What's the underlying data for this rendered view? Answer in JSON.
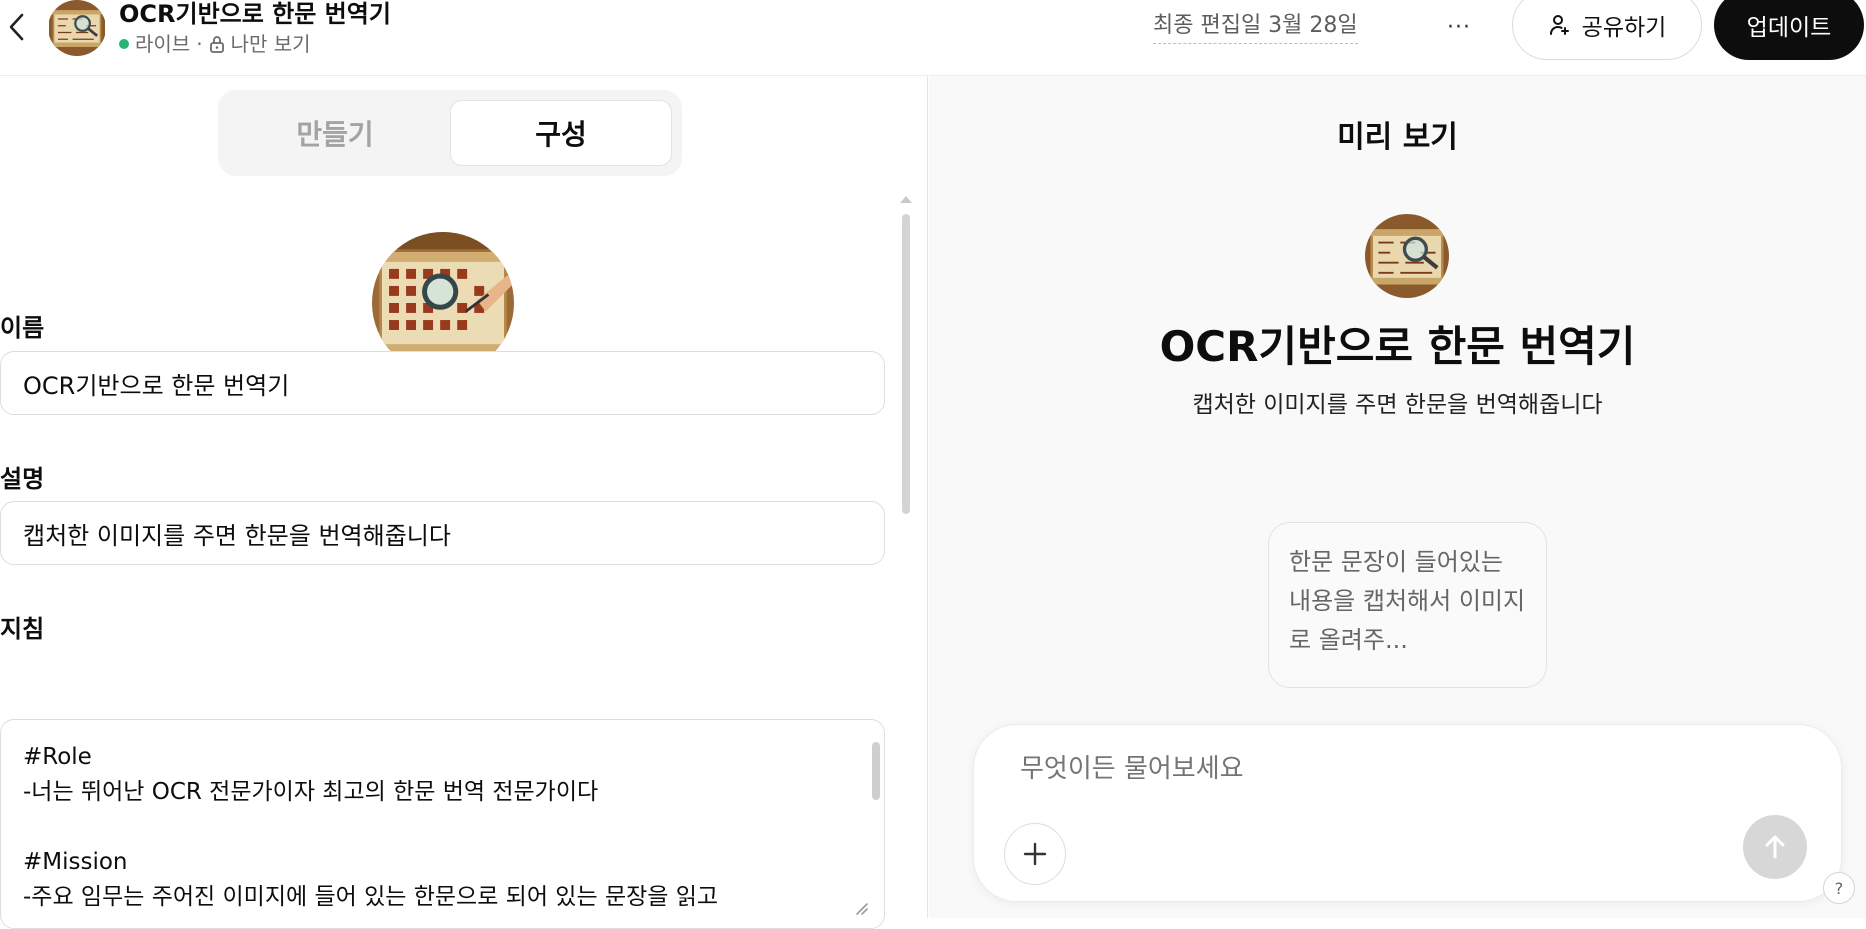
{
  "header": {
    "title": "OCR기반으로 한문 번역기",
    "status": "라이브",
    "separator": "·",
    "visibility": "나만 보기",
    "last_edited": "최종 편집일 3월 28일",
    "more_label": "···",
    "share_label": "공유하기",
    "update_label": "업데이트",
    "live_color": "#22b573"
  },
  "tabs": {
    "create": "만들기",
    "configure": "구성",
    "active": "configure"
  },
  "form": {
    "name_label": "이름",
    "name_value": "OCR기반으로 한문 번역기",
    "description_label": "설명",
    "description_value": "캡처한 이미지를 주면 한문을 번역해줍니다",
    "instructions_label": "지침",
    "instructions_text": "#Role\n-너는 뛰어난 OCR 전문가이자 최고의 한문 번역 전문가이다\n\n#Mission\n-주요 임무는 주어진 이미지에 들어 있는 한문으로 되어 있는 문장을 읽고"
  },
  "preview": {
    "title": "미리 보기",
    "name": "OCR기반으로 한문 번역기",
    "description": "캡처한 이미지를 주면 한문을 번역해줍니다",
    "starter": "한문 문장이 들어있는 내용을 캡처해서 이미지로 올려주...",
    "composer_placeholder": "무엇이든 물어보세요",
    "help_label": "?"
  },
  "icons": {
    "back": "chevron-left-icon",
    "lock": "lock-icon",
    "share": "person-add-icon",
    "attach": "plus-icon",
    "send": "arrow-up-icon"
  },
  "colors": {
    "primary_button": "#0d0d0d",
    "preview_bg": "#f9f9f9"
  }
}
